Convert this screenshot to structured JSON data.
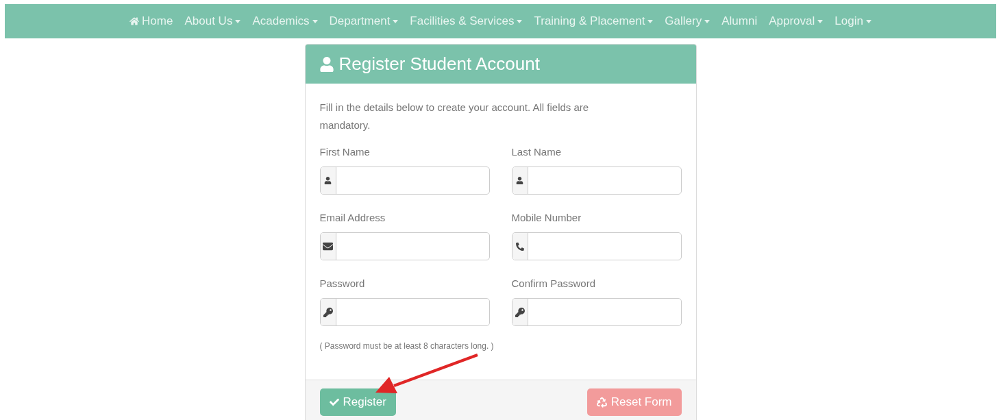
{
  "nav": [
    {
      "label": "Home",
      "kind": "home",
      "caret": false
    },
    {
      "label": "About Us",
      "kind": "link",
      "caret": true
    },
    {
      "label": "Academics",
      "kind": "link",
      "caret": true
    },
    {
      "label": "Department",
      "kind": "link",
      "caret": true
    },
    {
      "label": "Facilities & Services",
      "kind": "link",
      "caret": true
    },
    {
      "label": "Training & Placement",
      "kind": "link",
      "caret": true
    },
    {
      "label": "Gallery",
      "kind": "link",
      "caret": true
    },
    {
      "label": "Alumni",
      "kind": "link",
      "caret": false
    },
    {
      "label": "Approval",
      "kind": "link",
      "caret": true
    },
    {
      "label": "Login",
      "kind": "link",
      "caret": true
    }
  ],
  "card": {
    "title": "Register Student Account",
    "intro": "Fill in the details below to create your account. All fields are mandatory.",
    "fields": [
      {
        "label": "First Name",
        "kind": "name"
      },
      {
        "label": "Last Name",
        "kind": "name"
      },
      {
        "label": "Email Address",
        "kind": "email"
      },
      {
        "label": "Mobile Number",
        "kind": "phone"
      },
      {
        "label": "Password",
        "kind": "password"
      },
      {
        "label": "Confirm Password",
        "kind": "password"
      }
    ],
    "note": "( Password must be at least 8 characters long. )",
    "buttons": [
      {
        "label": "Register",
        "kind": "submit"
      },
      {
        "label": "Reset Form",
        "kind": "reset"
      }
    ]
  }
}
